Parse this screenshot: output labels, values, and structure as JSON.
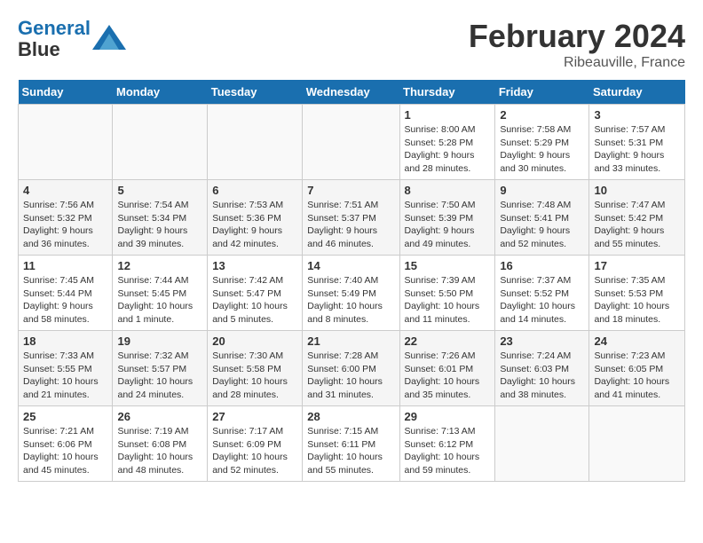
{
  "header": {
    "logo_line1": "General",
    "logo_line2": "Blue",
    "month": "February 2024",
    "location": "Ribeauville, France"
  },
  "days_of_week": [
    "Sunday",
    "Monday",
    "Tuesday",
    "Wednesday",
    "Thursday",
    "Friday",
    "Saturday"
  ],
  "weeks": [
    [
      {
        "day": "",
        "info": ""
      },
      {
        "day": "",
        "info": ""
      },
      {
        "day": "",
        "info": ""
      },
      {
        "day": "",
        "info": ""
      },
      {
        "day": "1",
        "info": "Sunrise: 8:00 AM\nSunset: 5:28 PM\nDaylight: 9 hours\nand 28 minutes."
      },
      {
        "day": "2",
        "info": "Sunrise: 7:58 AM\nSunset: 5:29 PM\nDaylight: 9 hours\nand 30 minutes."
      },
      {
        "day": "3",
        "info": "Sunrise: 7:57 AM\nSunset: 5:31 PM\nDaylight: 9 hours\nand 33 minutes."
      }
    ],
    [
      {
        "day": "4",
        "info": "Sunrise: 7:56 AM\nSunset: 5:32 PM\nDaylight: 9 hours\nand 36 minutes."
      },
      {
        "day": "5",
        "info": "Sunrise: 7:54 AM\nSunset: 5:34 PM\nDaylight: 9 hours\nand 39 minutes."
      },
      {
        "day": "6",
        "info": "Sunrise: 7:53 AM\nSunset: 5:36 PM\nDaylight: 9 hours\nand 42 minutes."
      },
      {
        "day": "7",
        "info": "Sunrise: 7:51 AM\nSunset: 5:37 PM\nDaylight: 9 hours\nand 46 minutes."
      },
      {
        "day": "8",
        "info": "Sunrise: 7:50 AM\nSunset: 5:39 PM\nDaylight: 9 hours\nand 49 minutes."
      },
      {
        "day": "9",
        "info": "Sunrise: 7:48 AM\nSunset: 5:41 PM\nDaylight: 9 hours\nand 52 minutes."
      },
      {
        "day": "10",
        "info": "Sunrise: 7:47 AM\nSunset: 5:42 PM\nDaylight: 9 hours\nand 55 minutes."
      }
    ],
    [
      {
        "day": "11",
        "info": "Sunrise: 7:45 AM\nSunset: 5:44 PM\nDaylight: 9 hours\nand 58 minutes."
      },
      {
        "day": "12",
        "info": "Sunrise: 7:44 AM\nSunset: 5:45 PM\nDaylight: 10 hours\nand 1 minute."
      },
      {
        "day": "13",
        "info": "Sunrise: 7:42 AM\nSunset: 5:47 PM\nDaylight: 10 hours\nand 5 minutes."
      },
      {
        "day": "14",
        "info": "Sunrise: 7:40 AM\nSunset: 5:49 PM\nDaylight: 10 hours\nand 8 minutes."
      },
      {
        "day": "15",
        "info": "Sunrise: 7:39 AM\nSunset: 5:50 PM\nDaylight: 10 hours\nand 11 minutes."
      },
      {
        "day": "16",
        "info": "Sunrise: 7:37 AM\nSunset: 5:52 PM\nDaylight: 10 hours\nand 14 minutes."
      },
      {
        "day": "17",
        "info": "Sunrise: 7:35 AM\nSunset: 5:53 PM\nDaylight: 10 hours\nand 18 minutes."
      }
    ],
    [
      {
        "day": "18",
        "info": "Sunrise: 7:33 AM\nSunset: 5:55 PM\nDaylight: 10 hours\nand 21 minutes."
      },
      {
        "day": "19",
        "info": "Sunrise: 7:32 AM\nSunset: 5:57 PM\nDaylight: 10 hours\nand 24 minutes."
      },
      {
        "day": "20",
        "info": "Sunrise: 7:30 AM\nSunset: 5:58 PM\nDaylight: 10 hours\nand 28 minutes."
      },
      {
        "day": "21",
        "info": "Sunrise: 7:28 AM\nSunset: 6:00 PM\nDaylight: 10 hours\nand 31 minutes."
      },
      {
        "day": "22",
        "info": "Sunrise: 7:26 AM\nSunset: 6:01 PM\nDaylight: 10 hours\nand 35 minutes."
      },
      {
        "day": "23",
        "info": "Sunrise: 7:24 AM\nSunset: 6:03 PM\nDaylight: 10 hours\nand 38 minutes."
      },
      {
        "day": "24",
        "info": "Sunrise: 7:23 AM\nSunset: 6:05 PM\nDaylight: 10 hours\nand 41 minutes."
      }
    ],
    [
      {
        "day": "25",
        "info": "Sunrise: 7:21 AM\nSunset: 6:06 PM\nDaylight: 10 hours\nand 45 minutes."
      },
      {
        "day": "26",
        "info": "Sunrise: 7:19 AM\nSunset: 6:08 PM\nDaylight: 10 hours\nand 48 minutes."
      },
      {
        "day": "27",
        "info": "Sunrise: 7:17 AM\nSunset: 6:09 PM\nDaylight: 10 hours\nand 52 minutes."
      },
      {
        "day": "28",
        "info": "Sunrise: 7:15 AM\nSunset: 6:11 PM\nDaylight: 10 hours\nand 55 minutes."
      },
      {
        "day": "29",
        "info": "Sunrise: 7:13 AM\nSunset: 6:12 PM\nDaylight: 10 hours\nand 59 minutes."
      },
      {
        "day": "",
        "info": ""
      },
      {
        "day": "",
        "info": ""
      }
    ]
  ]
}
